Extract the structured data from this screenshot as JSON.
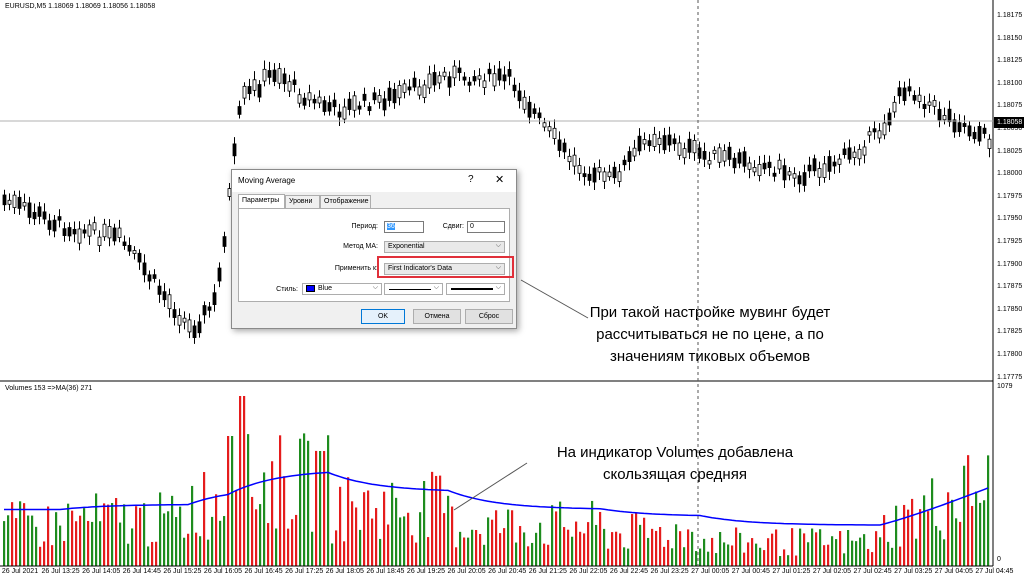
{
  "chart": {
    "symbol_info": "EURUSD,M5  1.18069 1.18069 1.18056 1.18058",
    "price_ticks": [
      "1.18175",
      "1.18150",
      "1.18125",
      "1.18100",
      "1.18075",
      "1.18050",
      "1.18025",
      "1.18000",
      "1.17975",
      "1.17950",
      "1.17925",
      "1.17900",
      "1.17875",
      "1.17850",
      "1.17825",
      "1.17800",
      "1.17775"
    ],
    "current_price": "1.18058",
    "volume_info": "Volumes 153  =>MA(36) 271",
    "volume_max": "1079",
    "volume_zero": "0",
    "time_ticks": [
      "26 Jul 2021",
      "26 Jul 13:25",
      "26 Jul 14:05",
      "26 Jul 14:45",
      "26 Jul 15:25",
      "26 Jul 16:05",
      "26 Jul 16:45",
      "26 Jul 17:25",
      "26 Jul 18:05",
      "26 Jul 18:45",
      "26 Jul 19:25",
      "26 Jul 20:05",
      "26 Jul 20:45",
      "26 Jul 21:25",
      "26 Jul 22:05",
      "26 Jul 22:45",
      "26 Jul 23:25",
      "27 Jul 00:05",
      "27 Jul 00:45",
      "27 Jul 01:25",
      "27 Jul 02:05",
      "27 Jul 02:45",
      "27 Jul 03:25",
      "27 Jul 04:05",
      "27 Jul 04:45"
    ],
    "colors": {
      "up_volume": "#1e8c1e",
      "down_volume": "#e51c1c",
      "ma_line": "#0000ff",
      "candle": "#000000"
    }
  },
  "dialog": {
    "title": "Moving Average",
    "help": "?",
    "close": "✕",
    "tabs": [
      "Параметры",
      "Уровни",
      "Отображение"
    ],
    "period_label": "Период:",
    "period_value": "36",
    "shift_label": "Сдвиг:",
    "shift_value": "0",
    "method_label": "Метод МА:",
    "method_value": "Exponential",
    "apply_label": "Применить к:",
    "apply_value": "First Indicator's Data",
    "style_label": "Стиль:",
    "style_color": "Blue",
    "ok_label": "OK",
    "cancel_label": "Отмена",
    "reset_label": "Сброс"
  },
  "annotations": {
    "settings_note_1": "При такой настройке мувинг будет",
    "settings_note_2": "рассчитываться не по цене, а по",
    "settings_note_3": "значениям тиковых объемов",
    "volumes_note_1": "На индикатор Volumes добавлена",
    "volumes_note_2": "скользящая средняя"
  }
}
